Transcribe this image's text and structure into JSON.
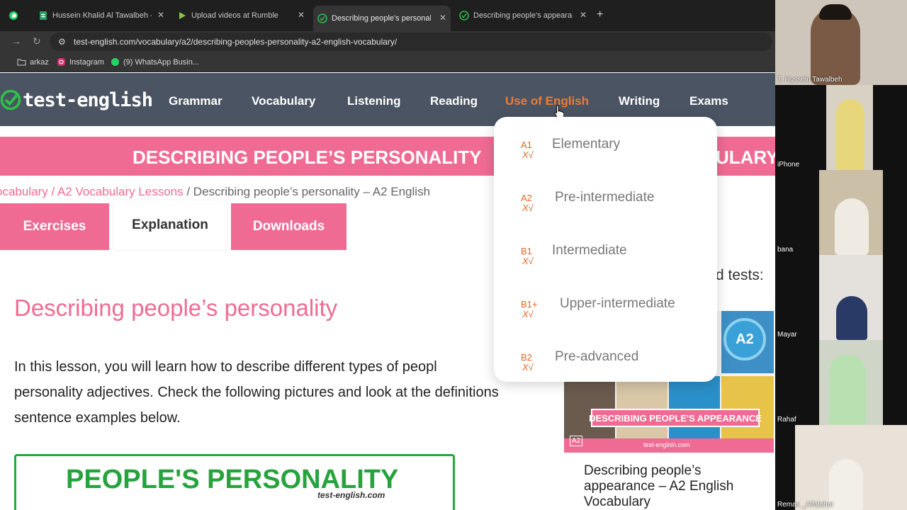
{
  "browser": {
    "tabs": [
      {
        "title": "",
        "icon": "whatsapp-icon"
      },
      {
        "title": "Hussein Khalid Al Tawalbeh - G",
        "icon": "sheets-icon"
      },
      {
        "title": "Upload videos at Rumble",
        "icon": "rumble-icon"
      },
      {
        "title": "Describing people's personality",
        "icon": "test-english-icon",
        "active": true
      },
      {
        "title": "Describing people's appearance",
        "icon": "test-english-icon"
      }
    ],
    "close_glyph": "✕",
    "add_tab_glyph": "+",
    "url": "test-english.com/vocabulary/a2/describing-peoples-personality-a2-english-vocabulary/",
    "bookmarks": [
      "arkaz",
      "Instagram",
      "(9) WhatsApp Busin..."
    ]
  },
  "site": {
    "logo": "test-english",
    "nav": [
      "Grammar",
      "Vocabulary",
      "Listening",
      "Reading",
      "Use of English",
      "Writing",
      "Exams"
    ],
    "active_nav": "Use of English",
    "banner_left": "DESCRIBING PEOPLE’S PERSONALITY",
    "banner_right": "ULARY",
    "breadcrumb": {
      "link1": "ocabulary",
      "sep": " / ",
      "link2": "A2 Vocabulary Lessons",
      "current": "Describing people’s personality – A2 English"
    },
    "tabs": [
      "Exercises",
      "Explanation",
      "Downloads"
    ],
    "heading": "Describing people’s personality",
    "paragraph": [
      "In this lesson, you will learn how to describe different types of peopl",
      "personality adjectives. Check the following pictures and look at the definitions",
      "sentence examples below."
    ],
    "image_title": "PEOPLE'S PERSONALITY",
    "image_sub": "test-english.com",
    "side_heading": "d tests:",
    "side_card": {
      "badge": "A2",
      "banner": "DESCRIBING PEOPLE'S APPEARANCE",
      "footer_site": "test-english.com",
      "footer_level": "A2",
      "title": "Describing people’s appearance – A2 English Vocabulary"
    },
    "dropdown": [
      {
        "level": "A1",
        "label": "Elementary"
      },
      {
        "level": "A2",
        "label": "Pre-intermediate"
      },
      {
        "level": "B1",
        "label": "Intermediate"
      },
      {
        "level": "B1+",
        "label": "Upper-intermediate"
      },
      {
        "level": "B2",
        "label": "Pre-advanced"
      }
    ],
    "check_mark": "X√"
  },
  "participants": [
    "T. Hussein Tawalbeh",
    "iPhone",
    "bana",
    "Mayar",
    "Rahaf",
    "Remas _Alfalahat"
  ],
  "colors": {
    "pink": "#f06b93",
    "orange": "#f07a33",
    "nav_bg": "#4a5462",
    "green": "#27a33e"
  }
}
